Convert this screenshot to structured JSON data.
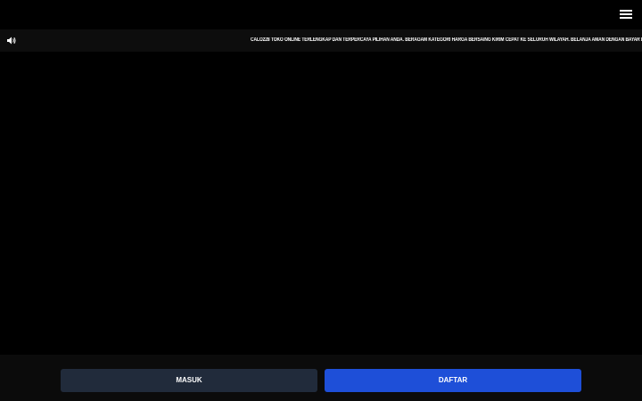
{
  "header": {
    "menu_icon": "hamburger-menu-icon"
  },
  "announcement": {
    "icon": "speaker-icon",
    "text": "CALO228 TOKO ONLINE TERLENGKAP DAN TERPERCAYA PILIHAN ANDA. BERAGAM KATEGORI HARGA BERSAING KIRIM CEPAT KE SELURUH WILAYAH. BELANJA AMAN DENGAN BAYAR DI TEMPAT DAN PROMO SETIAP HARI"
  },
  "footer": {
    "login_label": "MASUK",
    "register_label": "DAFTAR",
    "colors": {
      "login_bg": "#212b3b",
      "register_bg": "#1e4fd8"
    }
  }
}
